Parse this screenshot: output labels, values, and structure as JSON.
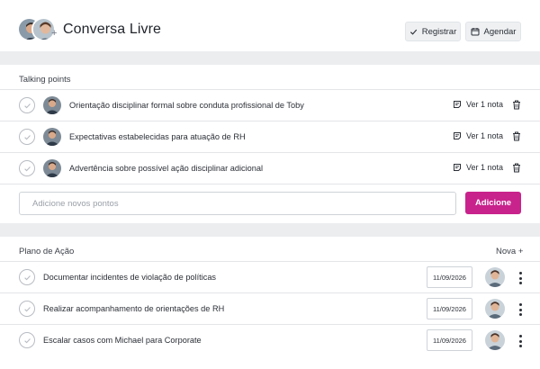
{
  "header": {
    "title": "Conversa Livre",
    "register_label": "Registrar",
    "schedule_label": "Agendar"
  },
  "talking_points": {
    "section_label": "Talking points",
    "items": [
      {
        "text": "Orientação disciplinar formal sobre conduta profissional de Toby",
        "note_label": "Ver 1 nota"
      },
      {
        "text": "Expectativas estabelecidas para atuação de RH",
        "note_label": "Ver 1 nota"
      },
      {
        "text": "Advertência sobre possível ação disciplinar adicional",
        "note_label": "Ver 1 nota"
      }
    ],
    "input_placeholder": "Adicione novos pontos",
    "add_label": "Adicione"
  },
  "action_plan": {
    "section_label": "Plano de Ação",
    "new_label": "Nova +",
    "items": [
      {
        "text": "Documentar incidentes de violação de políticas",
        "date": "11/09/2026"
      },
      {
        "text": "Realizar acompanhamento de orientações de RH",
        "date": "11/09/2026"
      },
      {
        "text": "Escalar casos com Michael para Corporate",
        "date": "11/09/2026"
      }
    ]
  },
  "colors": {
    "accent": "#c8238c",
    "band": "#ecedef"
  }
}
